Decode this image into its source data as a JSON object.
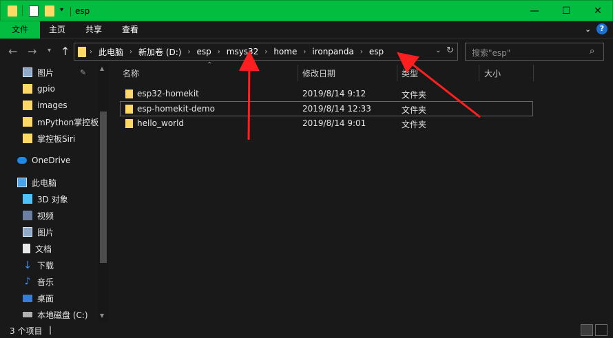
{
  "window": {
    "title": "esp",
    "accent": "#02bd3f"
  },
  "ribbon": {
    "tabs": [
      "文件",
      "主页",
      "共享",
      "查看"
    ],
    "active": "文件"
  },
  "address": {
    "segments": [
      "此电脑",
      "新加卷 (D:)",
      "esp",
      "msys32",
      "home",
      "ironpanda",
      "esp"
    ]
  },
  "search": {
    "placeholder": "搜索\"esp\""
  },
  "nav": {
    "quick_access": [
      {
        "label": "图片",
        "icon": "pictures-icon",
        "pinned": true
      },
      {
        "label": "gpio",
        "icon": "folder-icon"
      },
      {
        "label": "images",
        "icon": "folder-icon"
      },
      {
        "label": "mPython掌控板",
        "icon": "folder-icon"
      },
      {
        "label": "掌控板Siri",
        "icon": "folder-icon"
      }
    ],
    "onedrive": "OneDrive",
    "this_pc": "此电脑",
    "pc_items": [
      {
        "label": "3D 对象",
        "icon": "3d-objects-icon"
      },
      {
        "label": "视频",
        "icon": "videos-icon"
      },
      {
        "label": "图片",
        "icon": "pictures-icon"
      },
      {
        "label": "文档",
        "icon": "documents-icon"
      },
      {
        "label": "下载",
        "icon": "downloads-icon"
      },
      {
        "label": "音乐",
        "icon": "music-icon"
      },
      {
        "label": "桌面",
        "icon": "desktop-icon"
      },
      {
        "label": "本地磁盘 (C:)",
        "icon": "drive-icon"
      }
    ]
  },
  "columns": {
    "name": "名称",
    "modified": "修改日期",
    "type": "类型",
    "size": "大小"
  },
  "files": [
    {
      "name": "esp32-homekit",
      "modified": "2019/8/14 9:12",
      "type": "文件夹",
      "selected": false
    },
    {
      "name": "esp-homekit-demo",
      "modified": "2019/8/14 12:33",
      "type": "文件夹",
      "selected": true
    },
    {
      "name": "hello_world",
      "modified": "2019/8/14 9:01",
      "type": "文件夹",
      "selected": false
    }
  ],
  "status": {
    "count": "3 个项目",
    "cursor": "|"
  },
  "annotation": {
    "arrow_color": "#ff1f1f"
  }
}
